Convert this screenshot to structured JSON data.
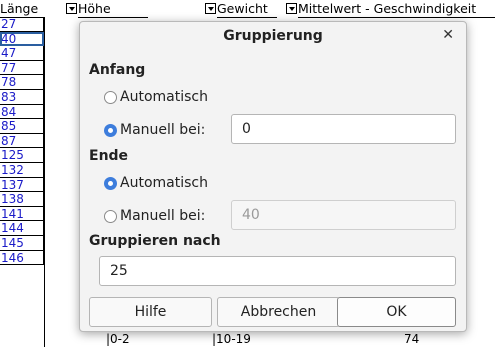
{
  "sheet": {
    "headers": [
      "Länge",
      "Höhe",
      "Gewicht",
      "Mittelwert - Geschwindigkeit"
    ],
    "rows": [
      "27",
      "40",
      "47",
      "77",
      "78",
      "83",
      "84",
      "85",
      "87",
      "125",
      "132",
      "137",
      "138",
      "141",
      "144",
      "145",
      "146"
    ],
    "last_row": {
      "hoehe": "0-2",
      "gewicht": "10-19",
      "mittelwert": "74"
    },
    "colors": {
      "row_text": "#1a1ac8",
      "selection": "#2a5ea0"
    }
  },
  "dialog": {
    "title": "Gruppierung",
    "close_icon": "close-icon",
    "start": {
      "heading": "Anfang",
      "automatic_label": "Automatisch",
      "manual_label": "Manuell bei:",
      "selected": "manual",
      "value": "0"
    },
    "end": {
      "heading": "Ende",
      "automatic_label": "Automatisch",
      "manual_label": "Manuell bei:",
      "selected": "automatic",
      "value": "40"
    },
    "group_by": {
      "heading": "Gruppieren nach",
      "value": "25"
    },
    "buttons": {
      "help": "Hilfe",
      "cancel": "Abbrechen",
      "ok": "OK"
    },
    "colors": {
      "radio_accent": "#3d7ddc",
      "background": "#f3f3f3"
    }
  }
}
